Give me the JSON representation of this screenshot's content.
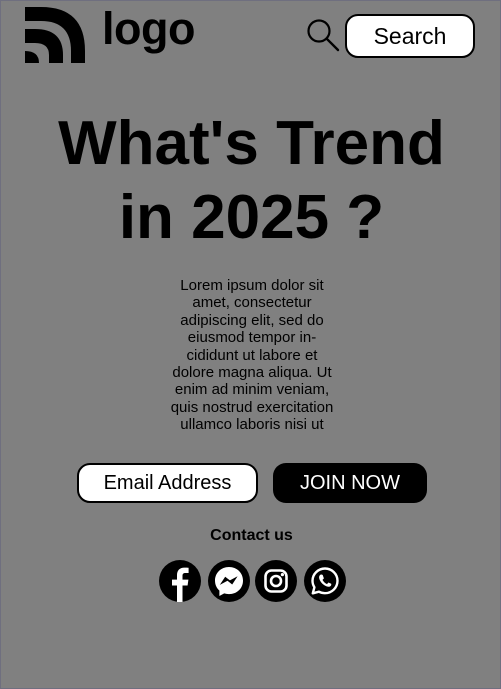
{
  "header": {
    "logo_text": "logo",
    "search_button_label": "Search"
  },
  "hero": {
    "headline_line1": "What's Trend",
    "headline_line2": "in 2025 ?",
    "body_line1": "Lorem ipsum dolor sit",
    "body_line2": "amet, consectetur",
    "body_line3": "adipiscing elit, sed do",
    "body_line4": "eiusmod tempor in-",
    "body_line5": "cididunt ut labore et",
    "body_line6": "dolore magna aliqua. Ut",
    "body_line7": "enim ad minim veniam,",
    "body_line8": "quis nostrud exercitation",
    "body_line9": "ullamco laboris nisi ut"
  },
  "signup": {
    "email_placeholder": "Email Address",
    "join_button_label": "JOIN NOW"
  },
  "contact": {
    "label": "Contact us",
    "socials": [
      "facebook-icon",
      "messenger-icon",
      "instagram-icon",
      "whatsapp-icon"
    ]
  },
  "colors": {
    "page_background": "#808080",
    "primary": "#000000",
    "button_text_light": "#ffffff"
  }
}
